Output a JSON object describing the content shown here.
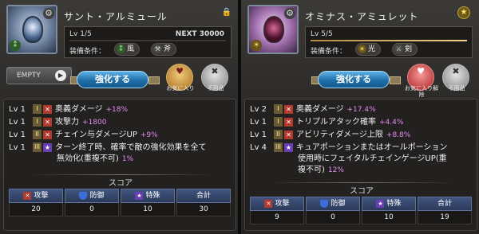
{
  "left": {
    "name": "サント・アルミュール",
    "level": "Lv 1/5",
    "next_label": "NEXT",
    "next_value": "30000",
    "level_progress": 0.0,
    "equip_label": "装備条件：",
    "conditions": [
      {
        "icon": "wind-icon",
        "glyph": "⁑",
        "label": "風",
        "color": "#2d5e2a"
      },
      {
        "icon": "axe-icon",
        "glyph": "⚒",
        "label": "斧",
        "color": "#4a4a4a"
      }
    ],
    "empty_label": "EMPTY",
    "enhance_label": "強化する",
    "favorite_label": "お気に入り",
    "unused_label": "不用品",
    "stats": [
      {
        "lv": "Lv 1",
        "tier": "I",
        "type": "atk",
        "name": "奥義ダメージ",
        "value": "+18%"
      },
      {
        "lv": "Lv 1",
        "tier": "I",
        "type": "atk",
        "name": "攻撃力",
        "value": "+1800"
      },
      {
        "lv": "Lv 1",
        "tier": "II",
        "type": "atk",
        "name": "チェイン与ダメージUP",
        "value": "+9%"
      },
      {
        "lv": "Lv 1",
        "tier": "III",
        "type": "spc",
        "name": "ターン終了時、確率で敵の強化効果を全て",
        "line2": "無効化(重複不可)",
        "value": "1%"
      }
    ],
    "score_title": "スコア",
    "scores": [
      {
        "label": "攻撃",
        "value": "20",
        "type": "atk"
      },
      {
        "label": "防御",
        "value": "0",
        "type": "def"
      },
      {
        "label": "特殊",
        "value": "10",
        "type": "spc"
      },
      {
        "label": "合計",
        "value": "30",
        "type": "total"
      }
    ]
  },
  "right": {
    "name": "オミナス・アミュレット",
    "level": "Lv 5/5",
    "level_progress": 1.0,
    "equip_label": "装備条件：",
    "conditions": [
      {
        "icon": "light-icon",
        "glyph": "☀",
        "label": "光",
        "color": "#6b5418"
      },
      {
        "icon": "sword-icon",
        "glyph": "⚔",
        "label": "剣",
        "color": "#4a4a4a"
      }
    ],
    "enhance_label": "強化する",
    "favorite_label": "お気に入り解除",
    "unused_label": "不用品",
    "stats": [
      {
        "lv": "Lv 2",
        "tier": "I",
        "type": "atk",
        "name": "奥義ダメージ",
        "value": "+17.4%"
      },
      {
        "lv": "Lv 1",
        "tier": "I",
        "type": "atk",
        "name": "トリプルアタック確率",
        "value": "+4.4%"
      },
      {
        "lv": "Lv 1",
        "tier": "II",
        "type": "atk",
        "name": "アビリティダメージ上限",
        "value": "+8.8%"
      },
      {
        "lv": "Lv 4",
        "tier": "III",
        "type": "spc",
        "name": "キュアポーションまたはオールポーション",
        "line2": "使用時にフェイタルチェインゲージUP(重",
        "line3": "複不可)",
        "value": "12%"
      }
    ],
    "score_title": "スコア",
    "scores": [
      {
        "label": "攻撃",
        "value": "9",
        "type": "atk"
      },
      {
        "label": "防御",
        "value": "0",
        "type": "def"
      },
      {
        "label": "特殊",
        "value": "10",
        "type": "spc"
      },
      {
        "label": "合計",
        "value": "19",
        "type": "total"
      }
    ]
  }
}
